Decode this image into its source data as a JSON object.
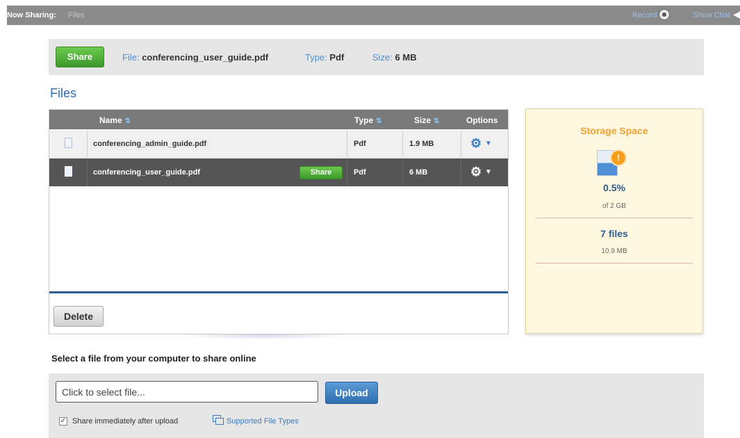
{
  "topbar": {
    "now_sharing_label": "Now Sharing:",
    "now_sharing_value": "Files",
    "record_label": "Record",
    "show_chat_label": "Show Chat"
  },
  "share_bar": {
    "share_button": "Share",
    "file_label": "File:",
    "file_value": "conferencing_user_guide.pdf",
    "type_label": "Type:",
    "type_value": "Pdf",
    "size_label": "Size:",
    "size_value": "6 MB"
  },
  "files": {
    "title": "Files",
    "columns": [
      "Name",
      "Type",
      "Size",
      "Options"
    ],
    "rows": [
      {
        "name": "conferencing_admin_guide.pdf",
        "type": "Pdf",
        "size": "1.9 MB",
        "selected": false
      },
      {
        "name": "conferencing_user_guide.pdf",
        "type": "Pdf",
        "size": "6 MB",
        "selected": true,
        "share_label": "Share"
      }
    ],
    "delete_button": "Delete"
  },
  "storage": {
    "title": "Storage Space",
    "percent": "0.5%",
    "of_total": "of 2 GB",
    "file_count": "7 files",
    "used": "10.9 MB",
    "warning_symbol": "!"
  },
  "upload": {
    "title": "Select a file from your computer to share online",
    "input_value": "Click to select file...",
    "upload_button": "Upload",
    "checkbox_label": "Share immediately after upload",
    "checkbox_checked": true,
    "supported_types_link": "Supported File Types"
  },
  "colors": {
    "accent_blue": "#2a6fb3",
    "share_green": "#4caf34",
    "storage_orange": "#f0a030",
    "header_gray": "#8a8a8a"
  }
}
